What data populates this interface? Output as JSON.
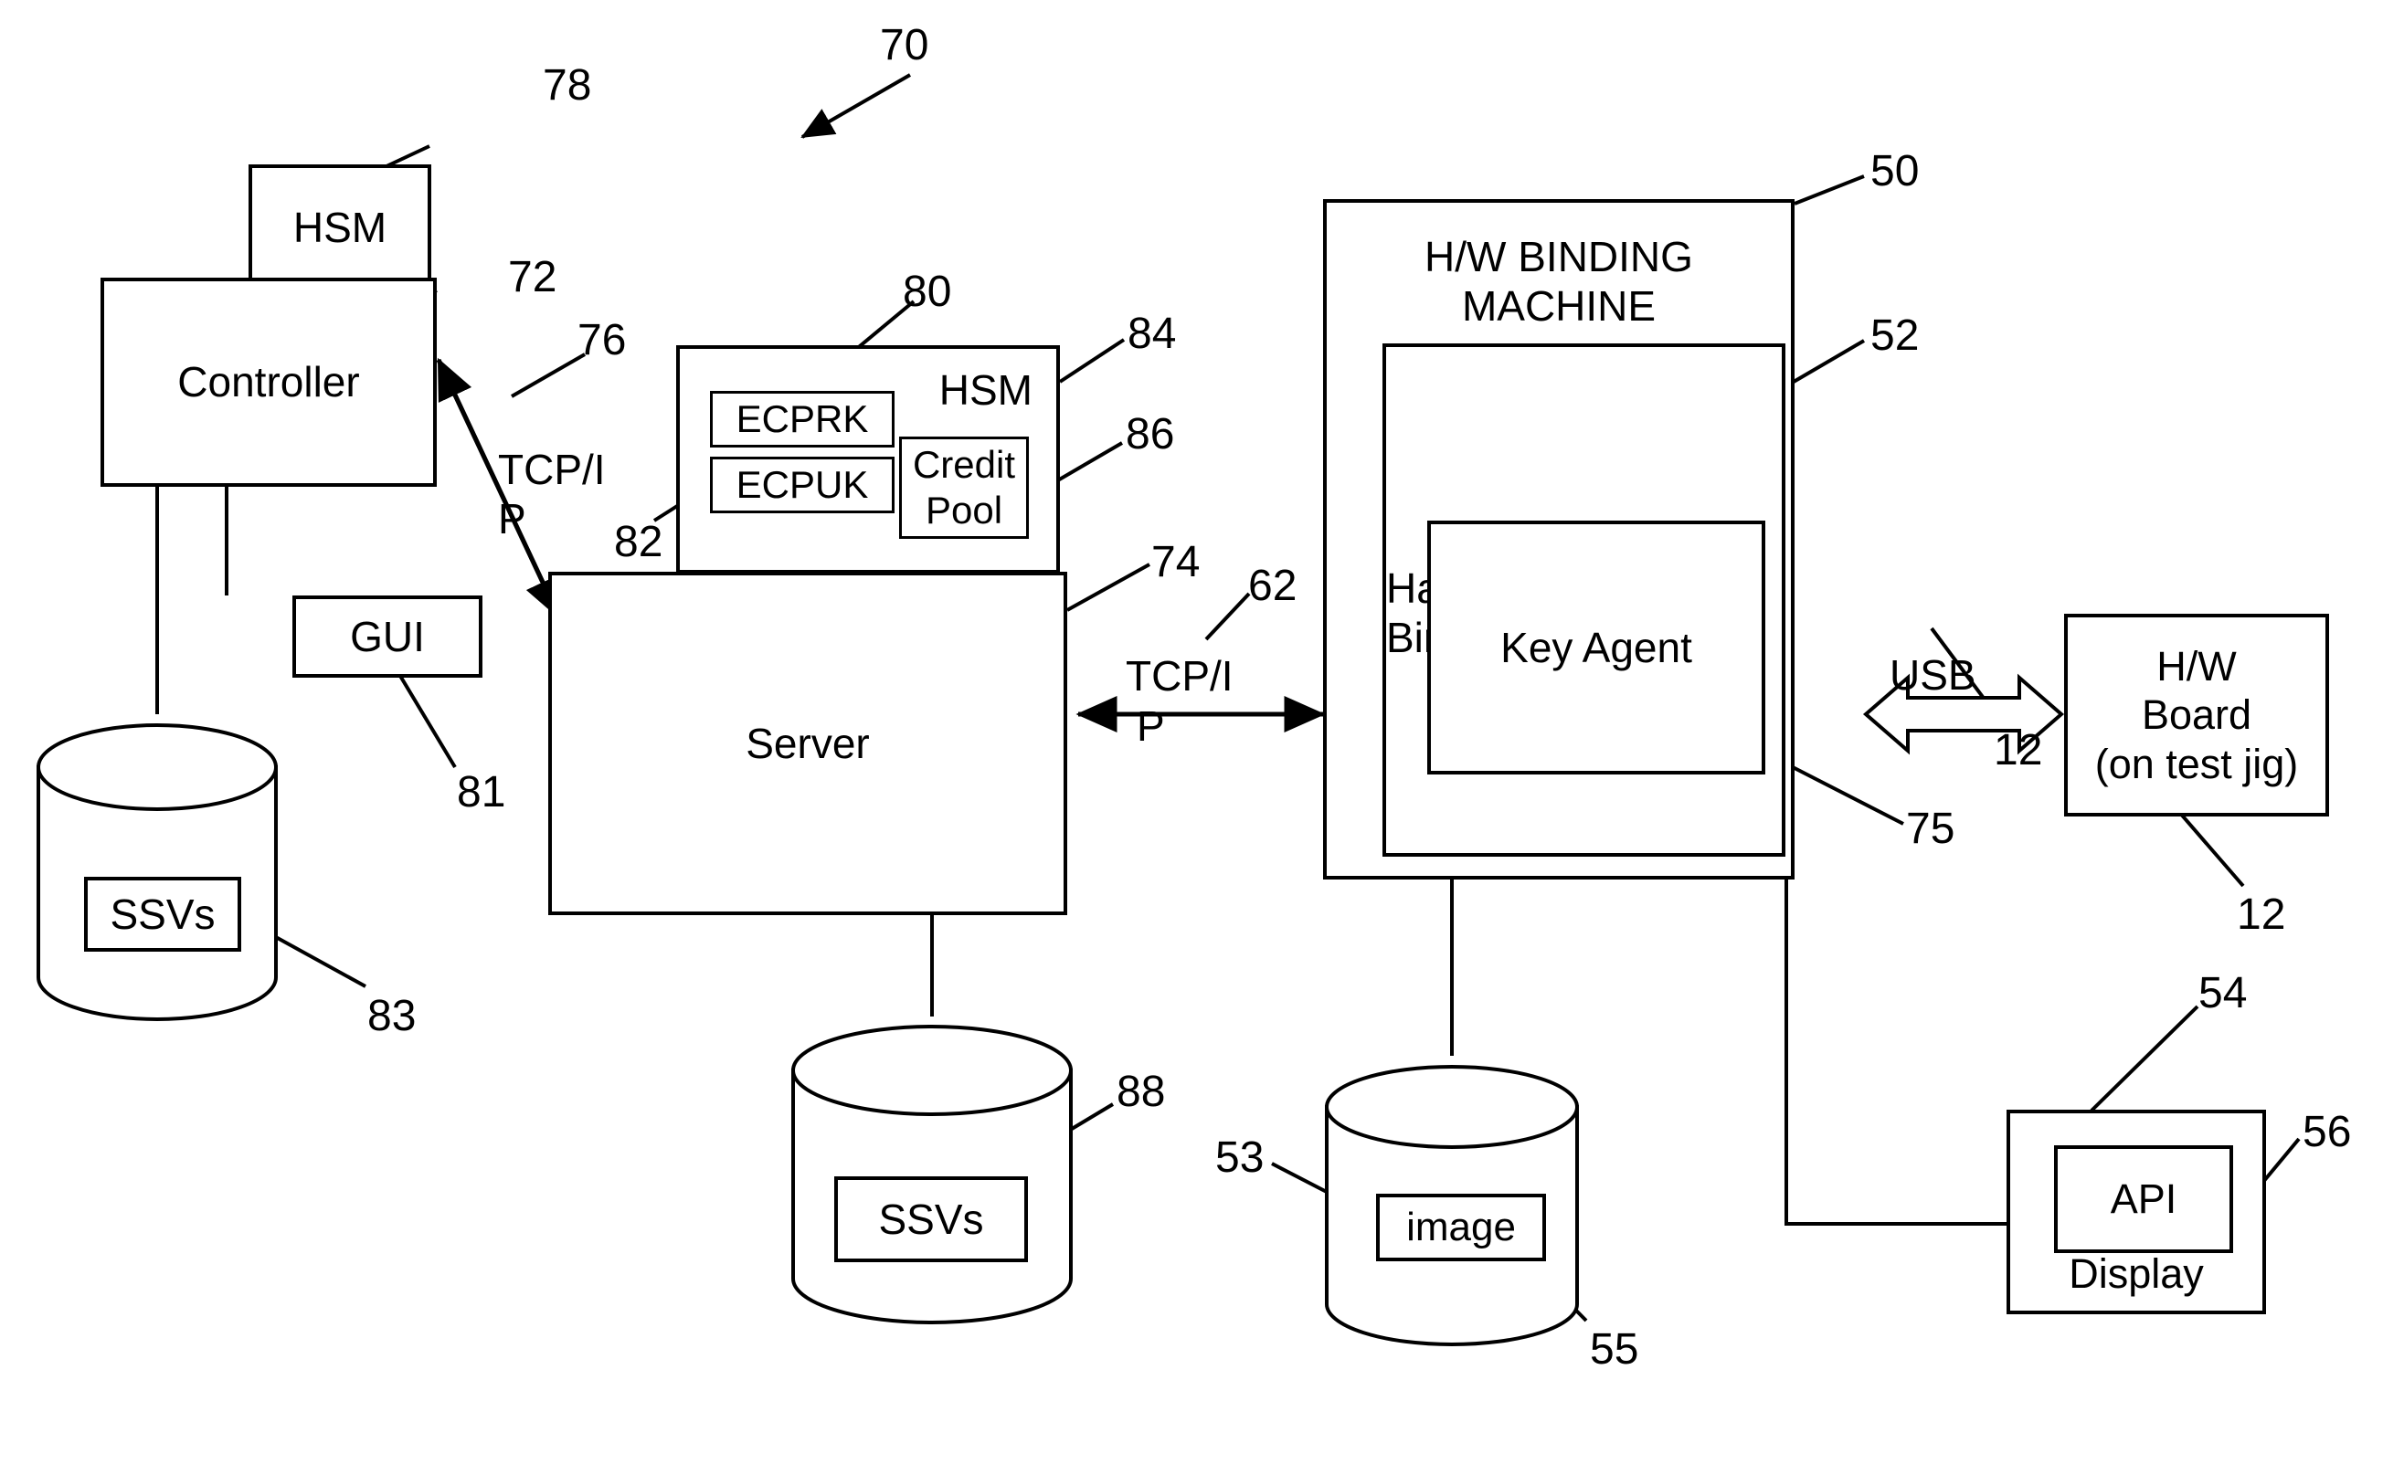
{
  "figure": {
    "ref_number": "70",
    "type": "patent-block-diagram"
  },
  "nodes": {
    "hsm_left": {
      "label": "HSM",
      "ref": "78"
    },
    "controller": {
      "label": "Controller",
      "ref": "72"
    },
    "gui": {
      "label": "GUI",
      "ref": "81"
    },
    "ssvs_left": {
      "label": "SSVs",
      "ref": "83"
    },
    "hsm_center": {
      "label": "HSM",
      "ref": "84"
    },
    "ecprk": {
      "label": "ECPRK",
      "ref": "80"
    },
    "ecpuk": {
      "label": "ECPUK",
      "ref": "82"
    },
    "credit_pool": {
      "label_line1": "Credit",
      "label_line2": "Pool",
      "ref": "86"
    },
    "server": {
      "label": "Server",
      "ref": "74"
    },
    "ssvs_center": {
      "label": "SSVs",
      "ref": "88"
    },
    "binding_machine": {
      "label": "H/W BINDING MACHINE",
      "ref": "50"
    },
    "binding_application": {
      "label_line1": "Hardware",
      "label_line2": "Binding Application",
      "ref": "52"
    },
    "key_agent": {
      "label": "Key Agent",
      "ref": "75"
    },
    "image_store": {
      "label": "image",
      "ref_inner": "53",
      "ref_outer": "55"
    },
    "hw_board": {
      "label_line1": "H/W",
      "label_line2": "Board",
      "label_line3": "(on test jig)",
      "ref_connector": "12",
      "ref_board": "12"
    },
    "display": {
      "label": "Display",
      "ref": "56"
    },
    "api": {
      "label": "API",
      "ref": "54"
    }
  },
  "connections": {
    "tcpip_left": {
      "label_line1": "TCP/I",
      "label_line2": "P",
      "ref": "76"
    },
    "tcpip_right": {
      "label_line1": "TCP/I",
      "label_line2": "P",
      "ref": "62"
    },
    "usb": {
      "label": "USB",
      "ref": "12"
    }
  },
  "colors": {
    "stroke": "#000000",
    "background": "#ffffff"
  }
}
